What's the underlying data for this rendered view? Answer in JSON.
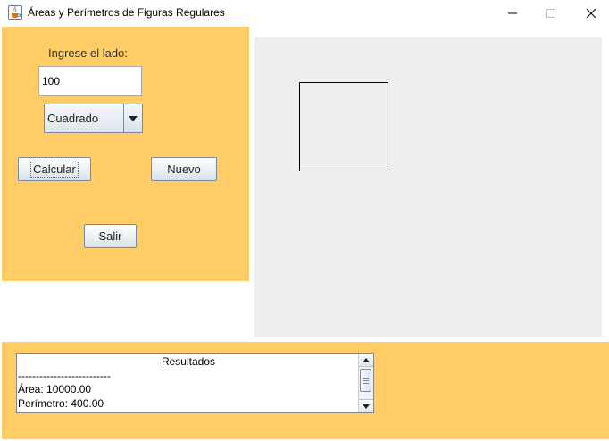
{
  "window": {
    "title": "Áreas y Perímetros de Figuras Regulares",
    "icon": "java-cup-icon",
    "controls": [
      "minimize",
      "maximize",
      "close"
    ]
  },
  "form": {
    "lado_label": "Ingrese el lado:",
    "lado_value": "100",
    "figure_selected": "Cuadrado",
    "calcular_label": "Calcular",
    "nuevo_label": "Nuevo",
    "salir_label": "Salir"
  },
  "canvas": {
    "shape": "square"
  },
  "results": {
    "header": "Resultados",
    "separator": "--------------------------",
    "area": "Área: 10000.00",
    "perimetro": "Perímetro: 400.00"
  },
  "colors": {
    "panel": "#ffcc66",
    "canvas": "#eeeeee"
  }
}
